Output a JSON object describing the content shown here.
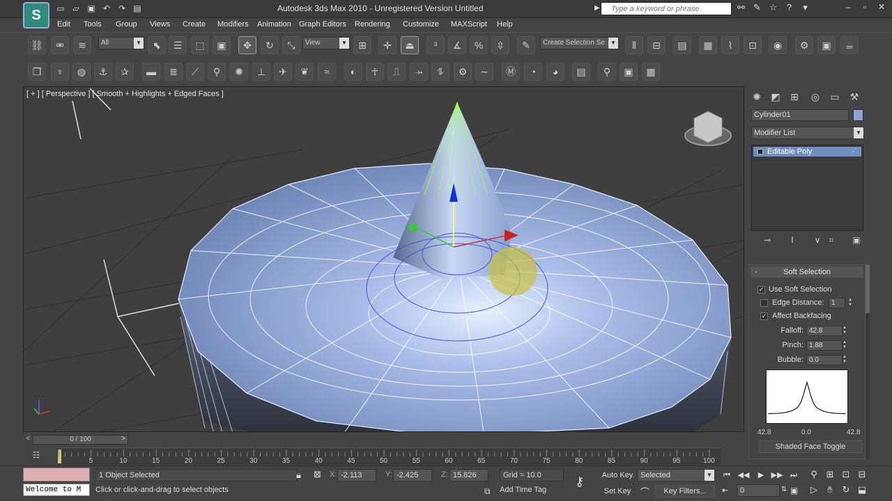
{
  "window": {
    "title": "Autodesk 3ds Max  2010   - Unregistered Version    Untitled",
    "search_placeholder": "Type a keyword or phrase",
    "logo": "S"
  },
  "quick_access": [
    "new-icon",
    "open-icon",
    "save-icon",
    "undo-icon",
    "redo-icon",
    "project-icon"
  ],
  "menu": [
    "Edit",
    "Tools",
    "Group",
    "Views",
    "Create",
    "Modifiers",
    "Animation",
    "Graph Editors",
    "Rendering",
    "Customize",
    "MAXScript",
    "Help"
  ],
  "toolbar": {
    "selection_filter": "All",
    "ref_coord": "View",
    "named_selection": "Create Selection Se"
  },
  "viewport": {
    "label": "[ + ] [ Perspective ] [ Smooth + Highlights + Edged Faces ]"
  },
  "command_panel": {
    "object_name": "Cylinder01",
    "modifier_list": "Modifier List",
    "stack_item": "Editable Poly",
    "rollout_title": "Soft Selection",
    "use_soft_selection": "Use Soft Selection",
    "edge_distance_label": "Edge Distance:",
    "edge_distance_value": "1",
    "affect_backfacing": "Affect Backfacing",
    "falloff_label": "Falloff:",
    "falloff_value": "42.8",
    "pinch_label": "Pinch:",
    "pinch_value": "1.88",
    "bubble_label": "Bubble:",
    "bubble_value": "0.0",
    "curve_left": "42.8",
    "curve_mid": "0.0",
    "curve_right": "42.8",
    "shaded_face_toggle": "Shaded Face Toggle"
  },
  "time": {
    "slider_text": "0 / 100",
    "ticks": [
      "5",
      "10",
      "15",
      "20",
      "25",
      "30",
      "35",
      "40",
      "45",
      "50",
      "55",
      "60",
      "65",
      "70",
      "75",
      "80",
      "85",
      "90",
      "95",
      "100"
    ]
  },
  "status": {
    "welcome": "Welcome to M",
    "selected": "1 Object Selected",
    "prompt": "Click or click-and-drag to select objects",
    "x_label": "X:",
    "x_value": "-2.113",
    "y_label": "Y:",
    "y_value": "-2.425",
    "z_label": "Z:",
    "z_value": "15.826",
    "grid": "Grid = 10.0",
    "add_time_tag": "Add Time Tag",
    "auto_key": "Auto Key",
    "set_key": "Set Key",
    "selected_dropdown": "Selected",
    "key_filters": "Key Filters...",
    "frame": "0"
  }
}
